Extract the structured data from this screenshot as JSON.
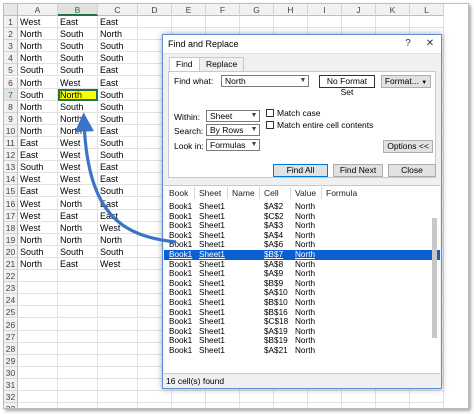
{
  "sheet": {
    "columns": [
      "A",
      "B",
      "C",
      "D",
      "E",
      "F",
      "G",
      "H",
      "I",
      "J",
      "K",
      "L"
    ],
    "active_column": "B",
    "active_row": 7,
    "selected_cell": {
      "row": 7,
      "col": 1
    },
    "rows": [
      [
        "West",
        "East",
        "East"
      ],
      [
        "North",
        "South",
        "North"
      ],
      [
        "North",
        "South",
        "South"
      ],
      [
        "North",
        "South",
        "South"
      ],
      [
        "South",
        "South",
        "East"
      ],
      [
        "North",
        "West",
        "East"
      ],
      [
        "South",
        "North",
        "South"
      ],
      [
        "North",
        "South",
        "South"
      ],
      [
        "North",
        "North",
        "South"
      ],
      [
        "North",
        "North",
        "East"
      ],
      [
        "East",
        "West",
        "South"
      ],
      [
        "East",
        "West",
        "South"
      ],
      [
        "South",
        "West",
        "East"
      ],
      [
        "West",
        "West",
        "East"
      ],
      [
        "East",
        "West",
        "South"
      ],
      [
        "West",
        "North",
        "East"
      ],
      [
        "West",
        "East",
        "East"
      ],
      [
        "West",
        "North",
        "West"
      ],
      [
        "North",
        "North",
        "North"
      ],
      [
        "South",
        "South",
        "South"
      ],
      [
        "North",
        "East",
        "West"
      ],
      [
        "",
        "",
        ""
      ],
      [
        "",
        "",
        ""
      ],
      [
        "",
        "",
        ""
      ],
      [
        "",
        "",
        ""
      ],
      [
        "",
        "",
        ""
      ],
      [
        "",
        "",
        ""
      ],
      [
        "",
        "",
        ""
      ],
      [
        "",
        "",
        ""
      ],
      [
        "",
        "",
        ""
      ],
      [
        "",
        "",
        ""
      ],
      [
        "",
        "",
        ""
      ],
      [
        "",
        "",
        ""
      ]
    ],
    "row_numbers": [
      "1",
      "2",
      "3",
      "4",
      "5",
      "6",
      "7",
      "8",
      "9",
      "10",
      "11",
      "12",
      "13",
      "14",
      "15",
      "16",
      "17",
      "18",
      "19",
      "20",
      "21",
      "22",
      "23",
      "24",
      "25",
      "26",
      "27",
      "28",
      "29",
      "30",
      "31",
      "32",
      "33"
    ]
  },
  "dialog": {
    "title": "Find and Replace",
    "help_label": "?",
    "close_label": "✕",
    "tabs": [
      "Find",
      "Replace"
    ],
    "active_tab": 0,
    "find_what_label": "Find what:",
    "find_what_value": "North",
    "no_format_set": "No Format Set",
    "format_label": "Format...",
    "within_label": "Within:",
    "within_value": "Sheet",
    "search_label": "Search:",
    "search_value": "By Rows",
    "look_in_label": "Look in:",
    "look_in_value": "Formulas",
    "match_case_label": "Match case",
    "match_entire_label": "Match entire cell contents",
    "options_label": "Options <<",
    "find_all_label": "Find All",
    "find_next_label": "Find Next",
    "close_button_label": "Close",
    "results": {
      "headers": [
        "Book",
        "Sheet",
        "Name",
        "Cell",
        "Value",
        "Formula"
      ],
      "rows": [
        [
          "Book1",
          "Sheet1",
          "",
          "$A$2",
          "North"
        ],
        [
          "Book1",
          "Sheet1",
          "",
          "$C$2",
          "North"
        ],
        [
          "Book1",
          "Sheet1",
          "",
          "$A$3",
          "North"
        ],
        [
          "Book1",
          "Sheet1",
          "",
          "$A$4",
          "North"
        ],
        [
          "Book1",
          "Sheet1",
          "",
          "$A$6",
          "North"
        ],
        [
          "Book1",
          "Sheet1",
          "",
          "$B$7",
          "North"
        ],
        [
          "Book1",
          "Sheet1",
          "",
          "$A$8",
          "North"
        ],
        [
          "Book1",
          "Sheet1",
          "",
          "$A$9",
          "North"
        ],
        [
          "Book1",
          "Sheet1",
          "",
          "$B$9",
          "North"
        ],
        [
          "Book1",
          "Sheet1",
          "",
          "$A$10",
          "North"
        ],
        [
          "Book1",
          "Sheet1",
          "",
          "$B$10",
          "North"
        ],
        [
          "Book1",
          "Sheet1",
          "",
          "$B$16",
          "North"
        ],
        [
          "Book1",
          "Sheet1",
          "",
          "$C$18",
          "North"
        ],
        [
          "Book1",
          "Sheet1",
          "",
          "$A$19",
          "North"
        ],
        [
          "Book1",
          "Sheet1",
          "",
          "$B$19",
          "North"
        ],
        [
          "Book1",
          "Sheet1",
          "",
          "$A$21",
          "North"
        ]
      ],
      "selected_index": 5
    },
    "status": "16 cell(s) found"
  },
  "colors": {
    "accent": "#217346",
    "selection_fill": "#ffff00",
    "result_highlight": "#0c5fd1",
    "arrow": "#3b73c9"
  }
}
